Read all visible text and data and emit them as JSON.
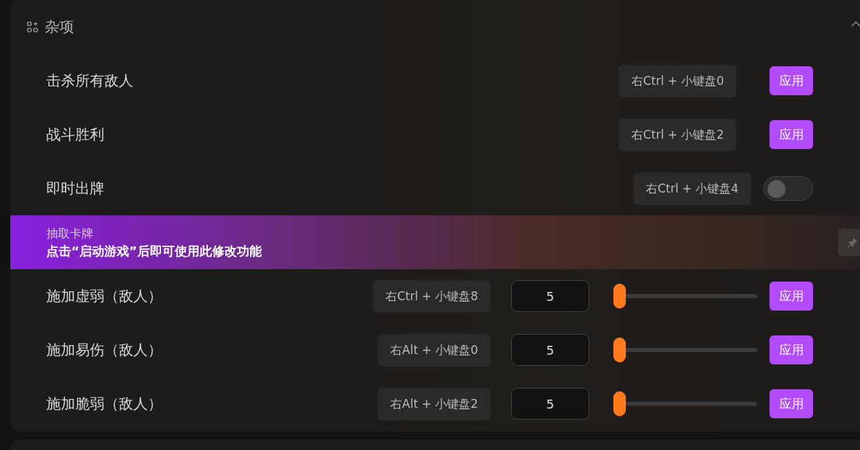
{
  "section": {
    "title": "杂项",
    "expanded": true
  },
  "rows": [
    {
      "kind": "button",
      "label": "击杀所有敌人",
      "hotkey": "右Ctrl + 小键盘0",
      "button": "应用"
    },
    {
      "kind": "button",
      "label": "战斗胜利",
      "hotkey": "右Ctrl + 小键盘2",
      "button": "应用"
    },
    {
      "kind": "toggle",
      "label": "即时出牌",
      "hotkey": "右Ctrl + 小键盘4",
      "on": false
    },
    {
      "kind": "banner",
      "title": "抽取卡牌",
      "message": "点击“启动游戏”后即可使用此修改功能"
    },
    {
      "kind": "slider",
      "label": "施加虚弱（敌人）",
      "hotkey": "右Ctrl + 小键盘8",
      "value": "5",
      "level": 0,
      "button": "应用"
    },
    {
      "kind": "slider",
      "label": "施加易伤（敌人）",
      "hotkey": "右Alt + 小键盘0",
      "value": "5",
      "level": 0,
      "button": "应用"
    },
    {
      "kind": "slider",
      "label": "施加脆弱（敌人）",
      "hotkey": "右Alt + 小键盘2",
      "value": "5",
      "level": 0,
      "button": "应用"
    }
  ]
}
